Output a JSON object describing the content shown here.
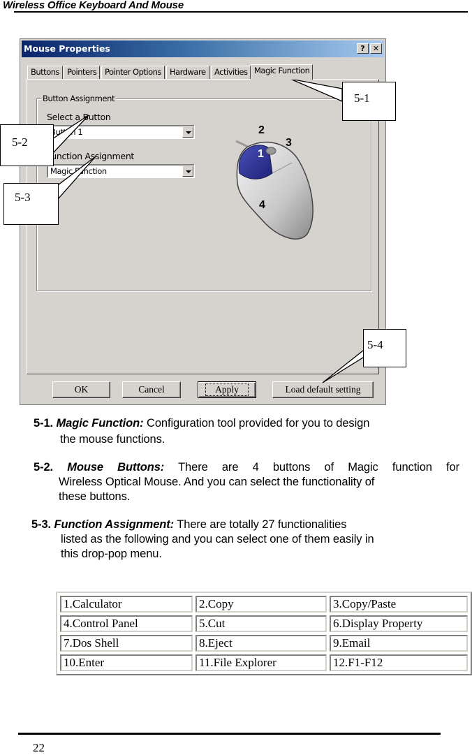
{
  "header": {
    "title": "Wireless Office Keyboard And Mouse"
  },
  "dialog": {
    "title": "Mouse Properties",
    "help_button": "?",
    "close_button": "✕",
    "tabs": [
      {
        "label": "Buttons",
        "active": false
      },
      {
        "label": "Pointers",
        "active": false
      },
      {
        "label": "Pointer Options",
        "active": false
      },
      {
        "label": "Hardware",
        "active": false
      },
      {
        "label": "Activities",
        "active": false
      },
      {
        "label": "Magic Function",
        "active": true
      }
    ],
    "group_label": "Button Assignment",
    "select_button": {
      "label": "Select a Button",
      "value": "Button 1"
    },
    "function_assignment": {
      "label": "Function Assignment",
      "value": "Magic Function"
    },
    "mouse_button_numbers": [
      "1",
      "2",
      "3",
      "4"
    ],
    "buttons": {
      "ok": "OK",
      "cancel": "Cancel",
      "apply": "Apply",
      "load_default": "Load default setting"
    }
  },
  "callouts": [
    "5-1",
    "5-2",
    "5-3",
    "5-4"
  ],
  "descriptions": [
    {
      "num": "5-1.",
      "term": "Magic Function:",
      "line1": "Configuration tool provided for you to design",
      "line2": "the mouse functions."
    },
    {
      "num": "5-2.",
      "term": "Mouse Buttons:",
      "line1": "There are 4 buttons of  Magic function for",
      "line2": "Wireless Optical Mouse. And you can select the functionality of",
      "line3": "these buttons."
    },
    {
      "num": "5-3.",
      "term": "Function Assignment:",
      "line1": "There are totally 27 functionalities",
      "line2": "listed as the following and you can select one of them easily in",
      "line3": "this drop-pop menu."
    }
  ],
  "functions_table": [
    [
      "1.Calculator",
      "2.Copy",
      "3.Copy/Paste"
    ],
    [
      "4.Control Panel",
      "5.Cut",
      "6.Display Property"
    ],
    [
      "7.Dos Shell",
      "8.Eject",
      "9.Email"
    ],
    [
      "10.Enter",
      "11.File Explorer",
      "12.F1-F12"
    ]
  ],
  "footer": {
    "page_number": "22"
  }
}
